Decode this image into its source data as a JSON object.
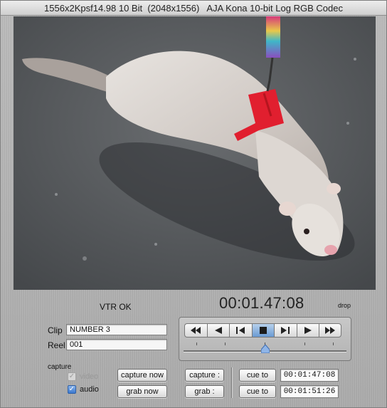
{
  "window": {
    "title": "1556x2Kpsf14.98 10 Bit  (2048x1556)   AJA Kona 10-bit Log RGB Codec"
  },
  "status": {
    "vtr": "VTR OK",
    "timecode": "00:01.47:08",
    "drop": "drop"
  },
  "clip": {
    "label": "Clip",
    "value": "NUMBER 3"
  },
  "reel": {
    "label": "Reel",
    "value": "001"
  },
  "transport": {
    "buttons": [
      "rewind-icon",
      "play-reverse-icon",
      "step-back-icon",
      "stop-icon",
      "step-forward-icon",
      "play-icon",
      "fast-forward-icon"
    ],
    "active": "stop-icon",
    "shuttle_position": 0.5
  },
  "capture": {
    "section_label": "capture",
    "video_label": "video",
    "video_checked": true,
    "video_enabled": false,
    "audio_label": "audio",
    "audio_checked": true,
    "capture_now_label": "capture now",
    "grab_now_label": "grab now",
    "capture_in_label": "capture :",
    "grab_in_label": "grab :",
    "cue_to_label_1": "cue to",
    "cue_to_label_2": "cue to",
    "in_timecode": "00:01:47:08",
    "out_timecode": "00:01:51:26"
  },
  "colors": {
    "active_transport": "#6a9ad3",
    "checkbox_accent": "#3b78cf"
  }
}
